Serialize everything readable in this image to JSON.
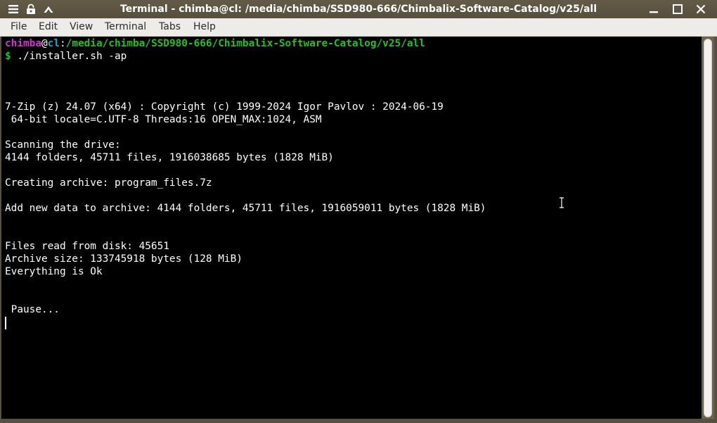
{
  "window": {
    "title": "Terminal - chimba@cl: /media/chimba/SSD980-666/Chimbalix-Software-Catalog/v25/all",
    "left_icons": [
      "hamburger-menu-icon",
      "lock-icon",
      "chevron-up-icon"
    ],
    "right_buttons": [
      "minimize-icon",
      "maximize-icon",
      "close-icon"
    ]
  },
  "menubar": {
    "items": [
      "File",
      "Edit",
      "View",
      "Terminal",
      "Tabs",
      "Help"
    ]
  },
  "terminal": {
    "prompt": {
      "user": "chimba",
      "at": "@",
      "host": "cl",
      "colon": ":",
      "path": "/media/chimba/SSD980-666/Chimbalix-Software-Catalog/v25/all",
      "dollar": "$",
      "command": " ./installer.sh -ap"
    },
    "lines": [
      "7-Zip (z) 24.07 (x64) : Copyright (c) 1999-2024 Igor Pavlov : 2024-06-19",
      " 64-bit locale=C.UTF-8 Threads:16 OPEN_MAX:1024, ASM",
      "Scanning the drive:",
      "4144 folders, 45711 files, 1916038685 bytes (1828 MiB)",
      "Creating archive: program_files.7z",
      "Add new data to archive: 4144 folders, 45711 files, 1916059011 bytes (1828 MiB)",
      "Files read from disk: 45651",
      "Archive size: 133745918 bytes (128 MiB)",
      "Everything is Ok",
      " Pause..."
    ]
  },
  "colors": {
    "titlebar": "#5e5644",
    "menubar": "#eeece9",
    "terminal_bg": "#000000",
    "prompt_user": "#d334d3",
    "prompt_host": "#11a8cd",
    "prompt_path": "#23c123"
  }
}
